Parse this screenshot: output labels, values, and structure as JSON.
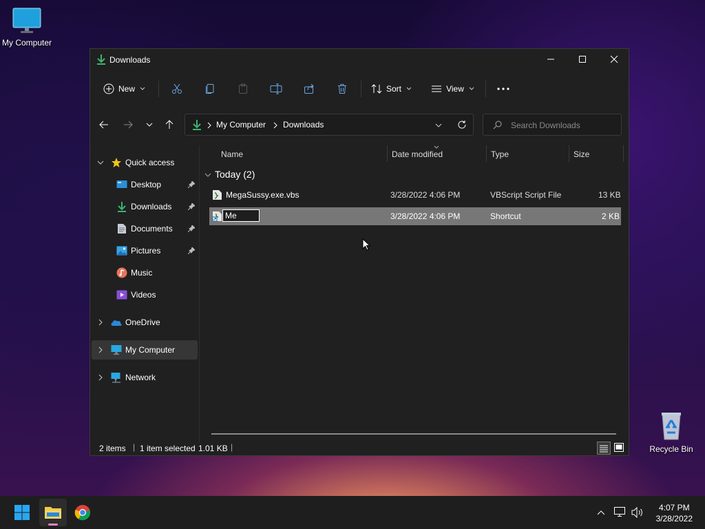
{
  "desktop": {
    "my_computer_label": "My Computer",
    "recycle_bin_label": "Recycle Bin"
  },
  "window": {
    "title": "Downloads",
    "controls": {
      "minimize": "minimize",
      "maximize": "maximize",
      "close": "close"
    }
  },
  "toolbar": {
    "new_label": "New",
    "sort_label": "Sort",
    "view_label": "View",
    "icons": [
      "cut-icon",
      "copy-icon",
      "paste-icon",
      "rename-icon",
      "share-icon",
      "delete-icon",
      "more-icon"
    ]
  },
  "address": {
    "crumbs": [
      "My Computer",
      "Downloads"
    ]
  },
  "search": {
    "placeholder": "Search Downloads"
  },
  "sidebar": {
    "quick_access": "Quick access",
    "items": [
      {
        "label": "Desktop",
        "pinned": true
      },
      {
        "label": "Downloads",
        "pinned": true
      },
      {
        "label": "Documents",
        "pinned": true
      },
      {
        "label": "Pictures",
        "pinned": true
      },
      {
        "label": "Music",
        "pinned": false
      },
      {
        "label": "Videos",
        "pinned": false
      }
    ],
    "onedrive": "OneDrive",
    "my_computer": "My Computer",
    "network": "Network"
  },
  "columns": {
    "name": "Name",
    "date": "Date modified",
    "type": "Type",
    "size": "Size"
  },
  "group_label": "Today (2)",
  "files": [
    {
      "name": "MegaSussy.exe.vbs",
      "date": "3/28/2022 4:06 PM",
      "type": "VBScript Script File",
      "size": "13 KB",
      "selected": false
    },
    {
      "name": "Me",
      "date": "3/28/2022 4:06 PM",
      "type": "Shortcut",
      "size": "2 KB",
      "selected": true,
      "renaming": true
    }
  ],
  "status": {
    "items": "2 items",
    "selected": "1 item selected",
    "size": "1.01 KB"
  },
  "taskbar": {
    "time": "4:07 PM",
    "date": "3/28/2022"
  },
  "colors": {
    "accent_green": "#3cb371",
    "selection": "#777777",
    "window_bg": "#202020"
  }
}
